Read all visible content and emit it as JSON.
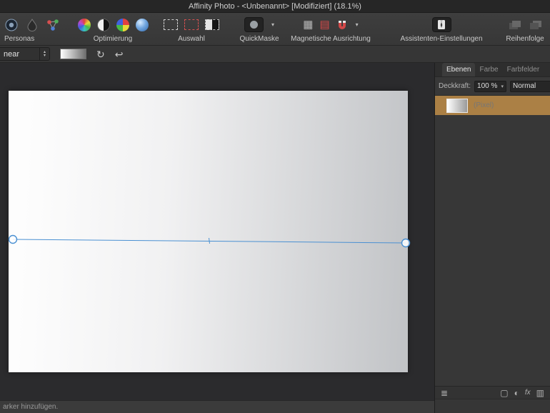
{
  "window": {
    "title": "Affinity Photo - <Unbenannt> [Modifiziert] (18.1%)"
  },
  "toolbar": {
    "personas_label": "Personas",
    "optimierung_label": "Optimierung",
    "auswahl_label": "Auswahl",
    "quickmaske_label": "QuickMaske",
    "magnetische_label": "Magnetische Ausrichtung",
    "assistenten_label": "Assistenten-Einstellungen",
    "reihenfolge_label": "Reihenfolge"
  },
  "context_bar": {
    "gradient_type_value": "near"
  },
  "layers_panel": {
    "tab_ebenen": "Ebenen",
    "tab_farbe": "Farbe",
    "tab_farbfelder": "Farbfelder",
    "opacity_label": "Deckkraft:",
    "opacity_value": "100 %",
    "blend_mode_value": "Normal",
    "layer_name": "(Pixel)"
  },
  "status_bar": {
    "text": "arker hinzufügen."
  },
  "icons": {
    "dropdown_arrow": "▾",
    "stepper_up": "▴",
    "stepper_down": "▾",
    "refresh": "↻",
    "reverse": "↩",
    "grid": "▦",
    "red_rows": "▤",
    "layers": "≣",
    "mask_square": "▢",
    "adjustment": "◐",
    "fx": "fx",
    "filter": "▥"
  },
  "colors": {
    "selection_orange": "#ab8045",
    "accent_blue": "#4a90d2"
  }
}
